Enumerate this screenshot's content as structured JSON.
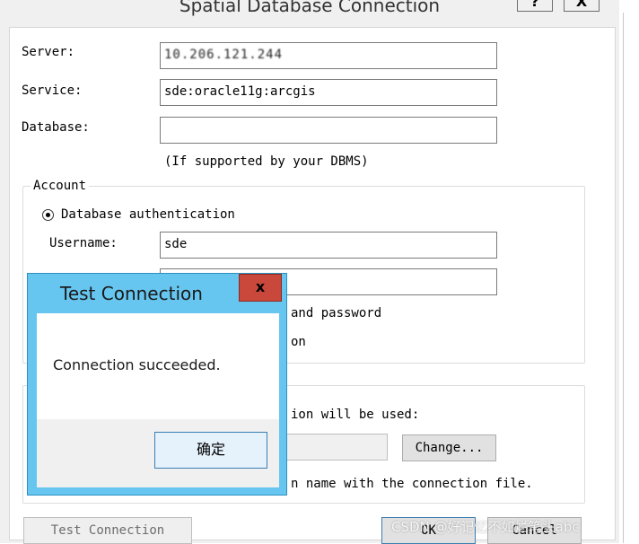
{
  "dialog": {
    "title": "Spatial Database Connection",
    "help_button": "?",
    "close_button": "X"
  },
  "form": {
    "server_label": "Server:",
    "server_value": "10.206.121.244",
    "service_label": "Service:",
    "service_value": "sde:oracle11g:arcgis",
    "database_label": "Database:",
    "database_value": "",
    "database_hint": "(If supported by your DBMS)"
  },
  "account": {
    "group_title": "Account",
    "db_auth_label": "Database authentication",
    "username_label": "Username:",
    "username_value": "sde",
    "password_value": "",
    "save_hint_fragment": "and password",
    "os_auth_fragment": "on"
  },
  "version": {
    "hint_fragment": "ion will be used:",
    "change_button": "Change...",
    "save_version_fragment": "n name with the connection file."
  },
  "footer": {
    "test_connection_button": "Test Connection",
    "ok_button": "OK",
    "cancel_button": "Cancel"
  },
  "message_box": {
    "title": "Test Connection",
    "close": "x",
    "message": "Connection succeeded.",
    "ok_button": "确定"
  },
  "watermark": "CSDN @好记忆不如烂笔头abc"
}
